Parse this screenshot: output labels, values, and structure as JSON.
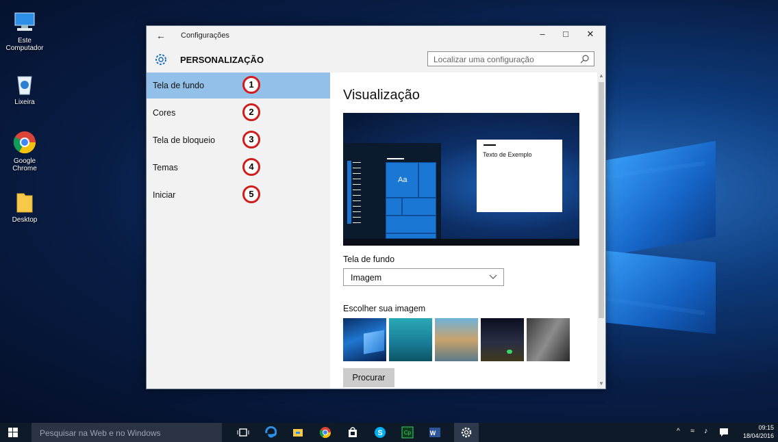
{
  "desktop": {
    "icons": [
      {
        "name": "Este Computador",
        "icon": "computer-icon"
      },
      {
        "name": "Lixeira",
        "icon": "recycle-bin-icon"
      },
      {
        "name": "Google Chrome",
        "icon": "chrome-icon"
      },
      {
        "name": "Desktop",
        "icon": "folder-icon"
      }
    ]
  },
  "window": {
    "app_title": "Configurações",
    "section_title": "PERSONALIZAÇÃO",
    "search_placeholder": "Localizar uma configuração",
    "sidebar": {
      "items": [
        {
          "label": "Tela de fundo",
          "active": true,
          "badge": "1"
        },
        {
          "label": "Cores",
          "active": false,
          "badge": "2"
        },
        {
          "label": "Tela de bloqueio",
          "active": false,
          "badge": "3"
        },
        {
          "label": "Temas",
          "active": false,
          "badge": "4"
        },
        {
          "label": "Iniciar",
          "active": false,
          "badge": "5"
        }
      ]
    },
    "content": {
      "preview_title": "Visualização",
      "sample_text": "Texto de Exemplo",
      "tile_text": "Aa",
      "background_label": "Tela de fundo",
      "background_value": "Imagem",
      "choose_label": "Escolher sua imagem",
      "browse_button": "Procurar"
    }
  },
  "taskbar": {
    "search_placeholder": "Pesquisar na Web e no Windows",
    "time": "09:15",
    "date": "18/04/2016"
  },
  "colors": {
    "accent": "#93c0e8",
    "badge_ring": "#d21c1c",
    "taskbar": "#0f1a29"
  }
}
